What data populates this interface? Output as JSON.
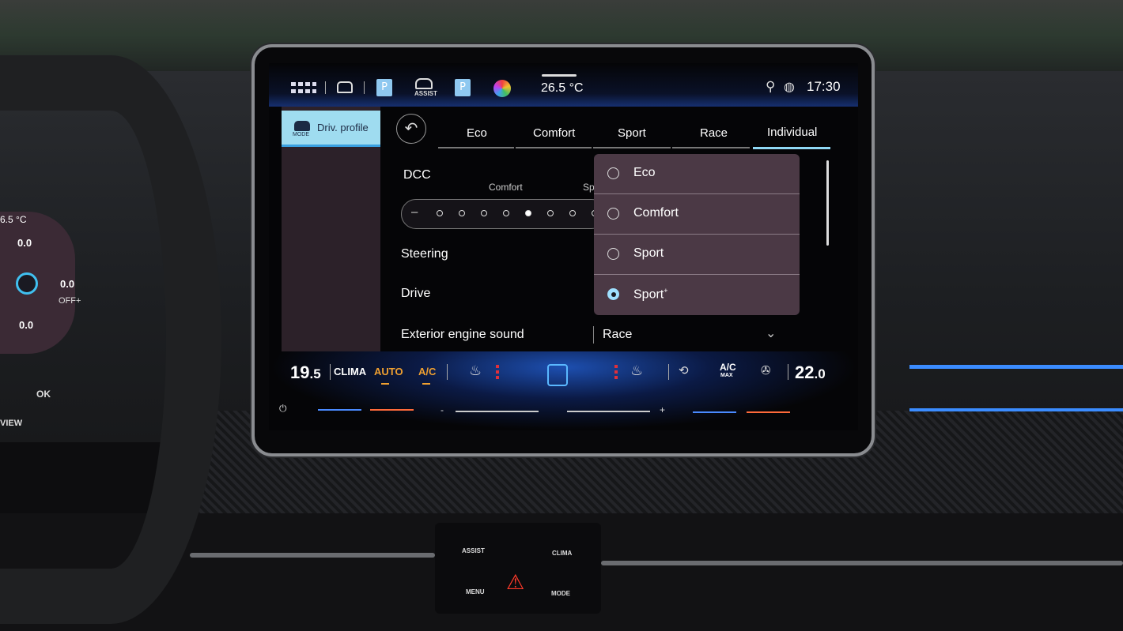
{
  "status_bar": {
    "icons": [
      "app-grid-icon",
      "car-icon",
      "parking-icon",
      "assist-icon",
      "parking-icon",
      "color-theme-icon",
      "user-location-icon",
      "globe-icon"
    ],
    "assist_label": "ASSIST",
    "parking_label": "P",
    "temperature": "26.5 °C",
    "time": "17:30"
  },
  "sidebar": {
    "active_item": {
      "label": "Driv. profile",
      "icon_label": "MODE"
    }
  },
  "tabs": [
    {
      "label": "Eco",
      "active": false
    },
    {
      "label": "Comfort",
      "active": false
    },
    {
      "label": "Sport",
      "active": false
    },
    {
      "label": "Race",
      "active": false
    },
    {
      "label": "Individual",
      "active": true
    }
  ],
  "settings": {
    "dcc": {
      "label": "DCC",
      "marker_comfort": "Comfort",
      "marker_sport": "Sp",
      "minus": "–",
      "selected_step": 4
    },
    "steering": {
      "label": "Steering"
    },
    "drive": {
      "label": "Drive"
    },
    "engine_sound": {
      "label": "Exterior engine sound",
      "value": "Race"
    }
  },
  "dropdown": {
    "options": [
      {
        "label": "Eco",
        "selected": false
      },
      {
        "label": "Comfort",
        "selected": false
      },
      {
        "label": "Sport",
        "selected": false
      },
      {
        "label": "Sport",
        "sup": "+",
        "selected": true
      }
    ]
  },
  "climate": {
    "left_temp_int": "19",
    "left_temp_dec": ".5",
    "clima": "CLIMA",
    "auto": "AUTO",
    "ac": "A/C",
    "ac_max": "A/C",
    "ac_max_sub": "MAX",
    "right_temp_int": "22",
    "right_temp_dec": ".0",
    "minus": "-",
    "plus": "+",
    "accent_color": "#f0a030"
  },
  "cluster": {
    "temp": "6.5 °C",
    "values": [
      "0.0",
      "0.0",
      "0.0"
    ],
    "paddle": "OFF+"
  },
  "wheel_buttons": {
    "ok": "OK",
    "view": "VIEW"
  },
  "console_buttons": {
    "assist": "ASSIST",
    "clima": "CLIMA",
    "menu": "MENU",
    "mode": "MODE"
  }
}
